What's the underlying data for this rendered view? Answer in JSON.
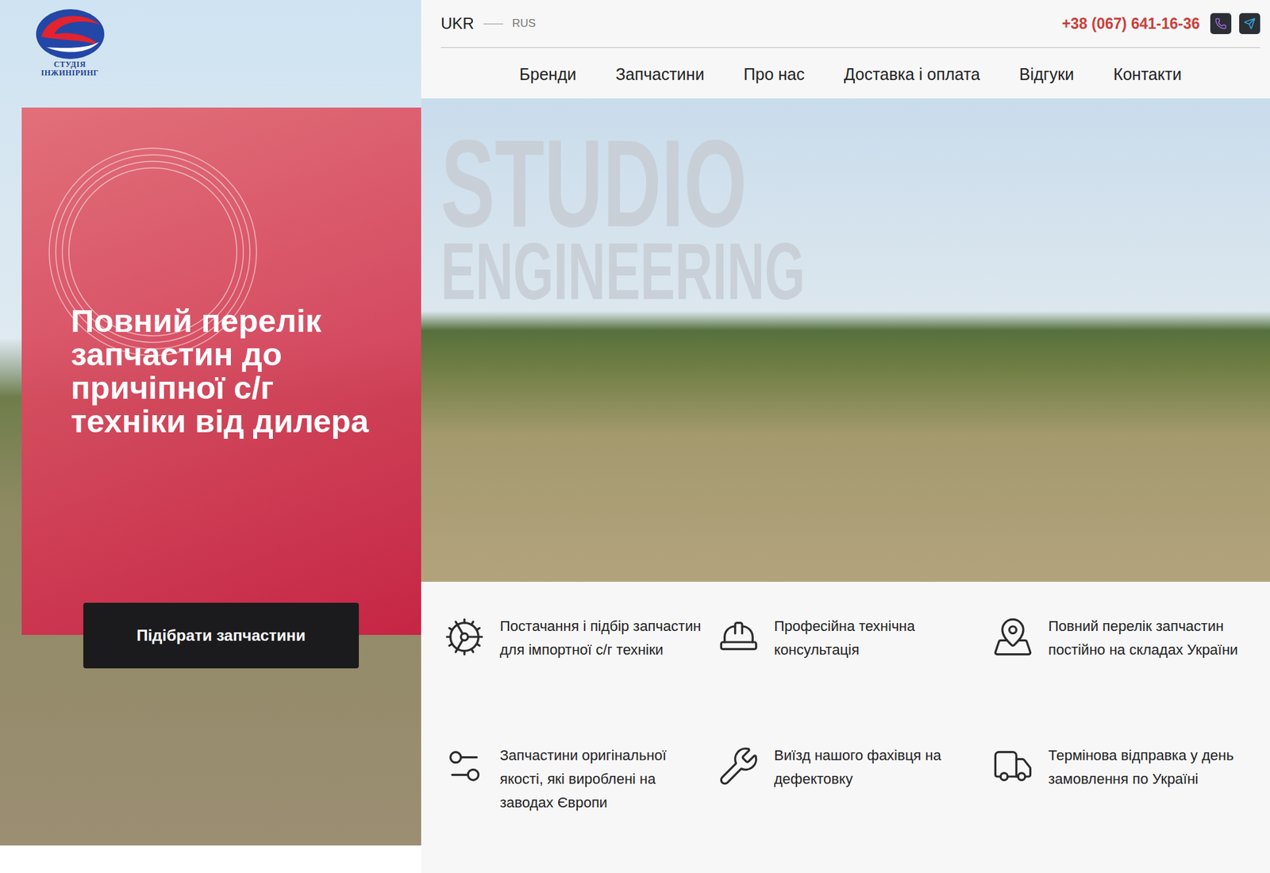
{
  "logo": {
    "line1": "СТУДІЯ",
    "line2": "ІНЖИНІРИНГ"
  },
  "languages": [
    {
      "label": "UKR",
      "selected": true
    },
    {
      "label": "RUS",
      "selected": false
    }
  ],
  "phone": "+38 (067) 641-16-36",
  "nav": [
    "Бренди",
    "Запчастини",
    "Про нас",
    "Доставка і оплата",
    "Відгуки",
    "Контакти"
  ],
  "hero": {
    "heading": "Повний перелік запчастин до причіпної с/г техніки від дилера",
    "button": "Підібрати запчастини",
    "watermark": [
      "STUDIO",
      "ENGINEERING"
    ]
  },
  "features": [
    {
      "kind": "parts",
      "text": "Постачання і підбір запчастин для імпортної с/г техніки"
    },
    {
      "kind": "consult",
      "text": "Професійна технічна консультація"
    },
    {
      "kind": "map",
      "text": "Повний перелік запчастин постійно на складах України"
    },
    {
      "kind": "gears",
      "text": "Запчастини оригінальної якості, які вироблені на заводах Європи"
    },
    {
      "kind": "master",
      "text": "Виїзд нашого фахівця на дефектовку"
    },
    {
      "kind": "truck",
      "text": "Термінова відправка у день замовлення по Україні"
    }
  ]
}
